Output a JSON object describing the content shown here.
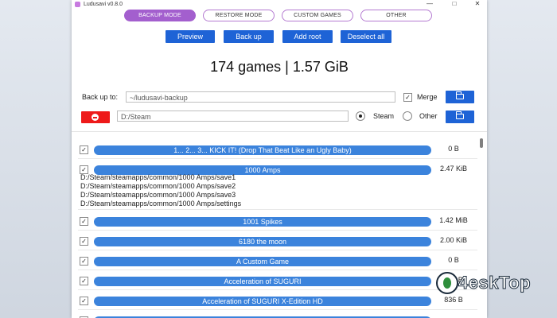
{
  "window": {
    "title": "Ludusavi v0.8.0",
    "controls": [
      "—",
      "□",
      "✕"
    ]
  },
  "modes": [
    {
      "label": "BACKUP MODE",
      "active": true
    },
    {
      "label": "RESTORE MODE",
      "active": false
    },
    {
      "label": "CUSTOM GAMES",
      "active": false
    },
    {
      "label": "OTHER",
      "active": false
    }
  ],
  "actions": {
    "preview": "Preview",
    "back_up": "Back up",
    "add_root": "Add root",
    "deselect_all": "Deselect all"
  },
  "summary": "174 games | 1.57 GiB",
  "backup_target": {
    "label": "Back up to:",
    "value": "~/ludusavi-backup",
    "merge_label": "Merge",
    "merge_checked": "✓"
  },
  "root": {
    "path": "D:/Steam",
    "steam_label": "Steam",
    "other_label": "Other",
    "selected": "Steam"
  },
  "games": [
    {
      "name": "1... 2... 3... KICK IT! (Drop That Beat Like an Ugly Baby)",
      "size": "0 B",
      "check": "✓"
    },
    {
      "name": "1000 Amps",
      "size": "2.47 KiB",
      "check": "✓",
      "paths": [
        "D:/Steam/steamapps/common/1000 Amps/save1",
        "D:/Steam/steamapps/common/1000 Amps/save2",
        "D:/Steam/steamapps/common/1000 Amps/save3",
        "D:/Steam/steamapps/common/1000 Amps/settings"
      ]
    },
    {
      "name": "1001 Spikes",
      "size": "1.42 MiB",
      "check": "✓"
    },
    {
      "name": "6180 the moon",
      "size": "2.00 KiB",
      "check": "✓"
    },
    {
      "name": "A Custom Game",
      "size": "0 B",
      "check": "✓"
    },
    {
      "name": "Acceleration of SUGURI",
      "size": "356 B",
      "check": "✓"
    },
    {
      "name": "Acceleration of SUGURI X-Edition HD",
      "size": "836 B",
      "check": "✓"
    },
    {
      "name": "",
      "size": "",
      "check": ""
    }
  ],
  "watermark": "4eskTop",
  "colors": {
    "accent_purple": "#a35fce",
    "button_blue": "#1e63d6",
    "game_bar": "#3b83dc",
    "remove_red": "#ee1a1a"
  }
}
